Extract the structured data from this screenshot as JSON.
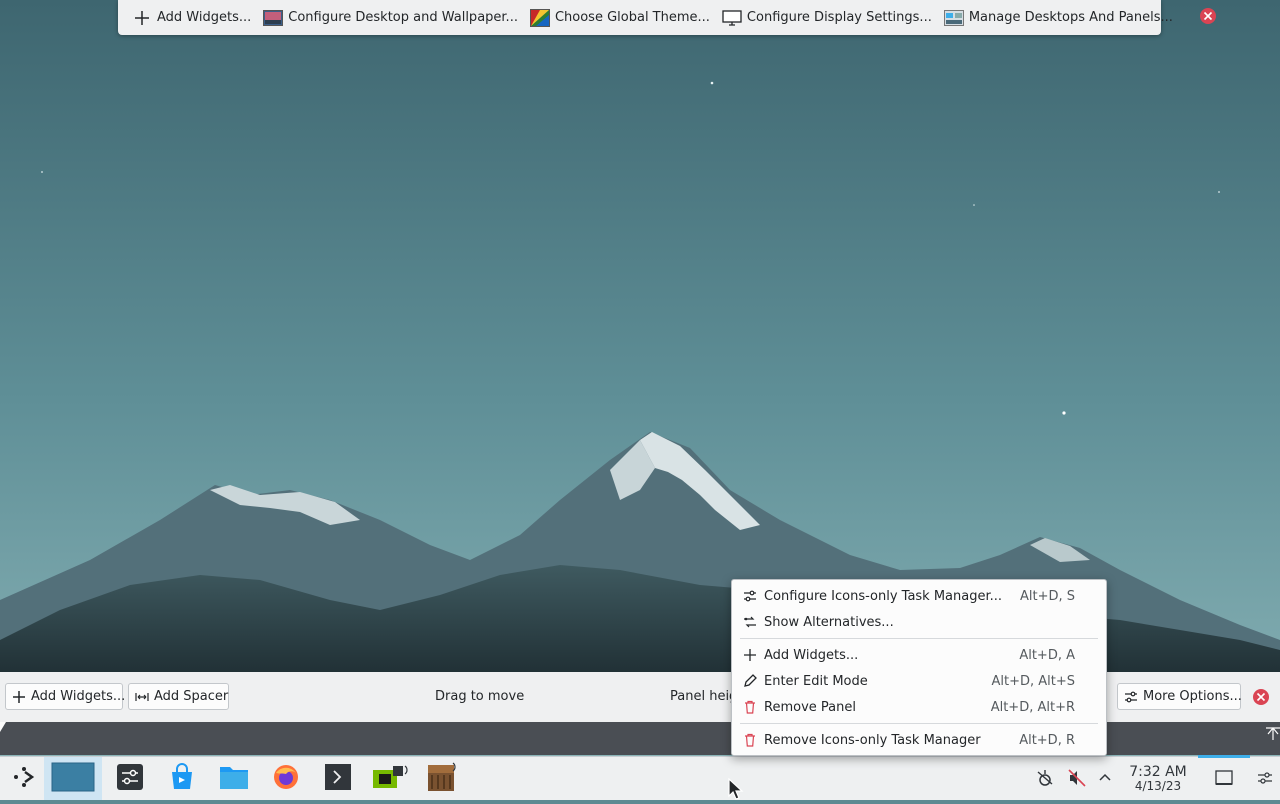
{
  "top_toolbar": {
    "add_widgets": "Add Widgets...",
    "configure_desktop": "Configure Desktop and Wallpaper...",
    "global_theme": "Choose Global Theme...",
    "display_settings": "Configure Display Settings...",
    "manage_panels": "Manage Desktops And Panels..."
  },
  "panel_controls": {
    "add_widgets": "Add Widgets...",
    "add_spacer": "Add Spacer",
    "drag_to_move": "Drag to move",
    "panel_height": "Panel height",
    "more_options": "More Options..."
  },
  "context_menu": {
    "items": [
      {
        "label": "Configure Icons-only Task Manager...",
        "shortcut": "Alt+D, S",
        "icon": "configure-icon"
      },
      {
        "label": "Show Alternatives...",
        "shortcut": "",
        "icon": "alternatives-icon"
      },
      {
        "label": "Add Widgets...",
        "shortcut": "Alt+D, A",
        "icon": "plus-icon"
      },
      {
        "label": "Enter Edit Mode",
        "shortcut": "Alt+D, Alt+S",
        "icon": "pencil-icon"
      },
      {
        "label": "Remove Panel",
        "shortcut": "Alt+D, Alt+R",
        "icon": "trash-icon"
      },
      {
        "label": "Remove Icons-only Task Manager",
        "shortcut": "Alt+D, R",
        "icon": "trash-icon"
      }
    ]
  },
  "taskbar": {
    "apps": [
      "application-launcher",
      "pager",
      "system-settings",
      "discover",
      "dolphin",
      "firefox",
      "konsole",
      "nvidia-settings",
      "minecraft"
    ],
    "clock_time": "7:32 AM",
    "clock_date": "4/13/23"
  },
  "colors": {
    "accent": "#3daee9",
    "danger": "#da4453",
    "panel_bg": "#eff0f1"
  }
}
